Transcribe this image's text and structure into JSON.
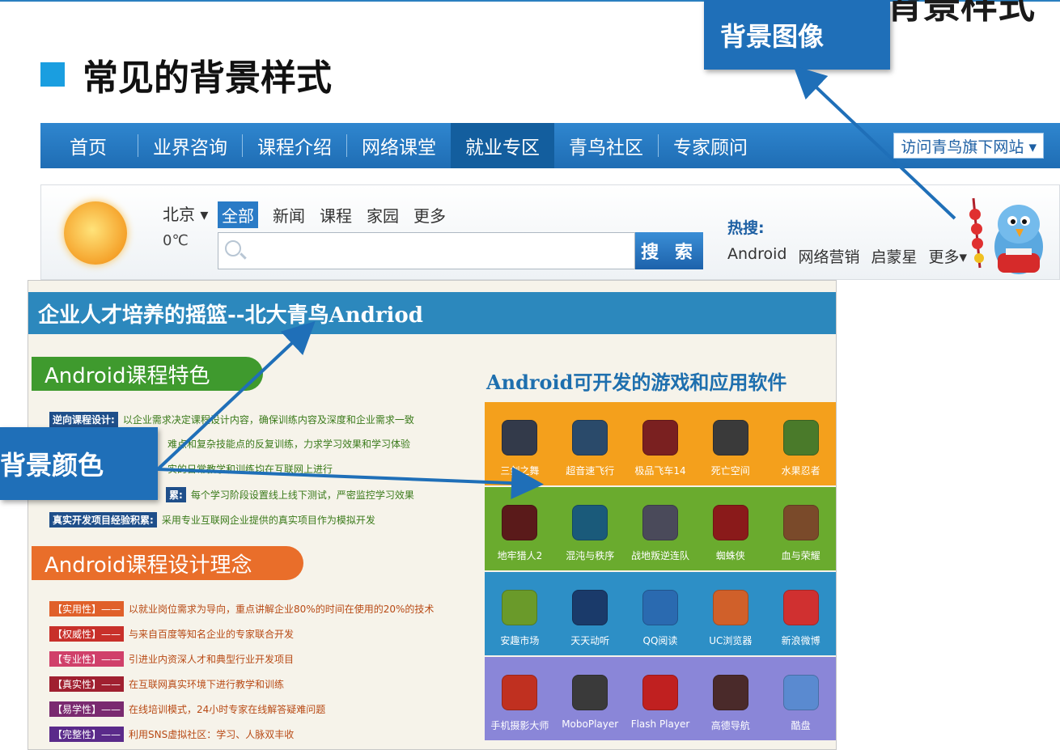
{
  "slide": {
    "corner_title": "背景样式",
    "heading": "常见的背景样式",
    "callout_image": "背景图像",
    "callout_color": "背景颜色"
  },
  "nav": {
    "items": [
      "首页",
      "业界咨询",
      "课程介绍",
      "网络课堂",
      "就业专区",
      "青鸟社区",
      "专家顾问"
    ],
    "active_index": 4,
    "visit": "访问青鸟旗下网站 ▾"
  },
  "search": {
    "city": "北京 ▾",
    "temp": "0℃",
    "tabs": [
      "全部",
      "新闻",
      "课程",
      "家园",
      "更多"
    ],
    "button": "搜 索",
    "hot_label": "热搜:",
    "hot_links": [
      "Android",
      "网络营销",
      "启蒙星",
      "更多▾"
    ]
  },
  "content": {
    "title": "企业人才培养的摇篮--北大青鸟Andriod",
    "features_heading": "Android课程特色",
    "features": [
      {
        "label": "逆向课程设计:",
        "text": "以企业需求决定课程设计内容，确保训练内容及深度和企业需求一致"
      },
      {
        "label": "",
        "text": "难点和复杂技能点的反复训练，力求学习效果和学习体验"
      },
      {
        "label": "",
        "text": "实的日常教学和训练均在互联网上进行"
      },
      {
        "label": "累:",
        "text": "每个学习阶段设置线上线下测试，严密监控学习效果"
      },
      {
        "label": "真实开发项目经验积累:",
        "text": "采用专业互联网企业提供的真实项目作为模拟开发"
      }
    ],
    "ideas_heading": "Android课程设计理念",
    "ideas": [
      {
        "label": "【实用性】——",
        "text": "以就业岗位需求为导向，重点讲解企业80%的时间在使用的20%的技术",
        "color": "#e0602a"
      },
      {
        "label": "【权威性】——",
        "text": "与来自百度等知名企业的专家联合开发",
        "color": "#c8302a"
      },
      {
        "label": "【专业性】——",
        "text": "引进业内资深人才和典型行业开发项目",
        "color": "#d0406a"
      },
      {
        "label": "【真实性】——",
        "text": "在互联网真实环境下进行教学和训练",
        "color": "#a02030"
      },
      {
        "label": "【易学性】——",
        "text": "在线培训模式，24小时专家在线解答疑难问题",
        "color": "#7a2a70"
      },
      {
        "label": "【完整性】——",
        "text": "利用SNS虚拟社区：学习、人脉双丰收",
        "color": "#5a2a8a"
      }
    ],
    "apps_title": "Android可开发的游戏和应用软件",
    "app_rows": [
      {
        "bg": "#f4a01c",
        "apps": [
          "三剑之舞",
          "超音速飞行",
          "极品飞车14",
          "死亡空间",
          "水果忍者"
        ]
      },
      {
        "bg": "#6aab2e",
        "apps": [
          "地牢猎人2",
          "混沌与秩序",
          "战地叛逆连队",
          "蜘蛛侠",
          "血与荣耀"
        ]
      },
      {
        "bg": "#2d8fc6",
        "apps": [
          "安趣市场",
          "天天动听",
          "QQ阅读",
          "UC浏览器",
          "新浪微博"
        ]
      },
      {
        "bg": "#8a86d8",
        "apps": [
          "手机摄影大师",
          "MoboPlayer",
          "Flash Player",
          "高德导航",
          "酷盘"
        ]
      }
    ]
  },
  "colors": {
    "nav_blue": "#1f6db4",
    "callout_blue": "#1f6fb8",
    "title_bar": "#2c88bd"
  }
}
